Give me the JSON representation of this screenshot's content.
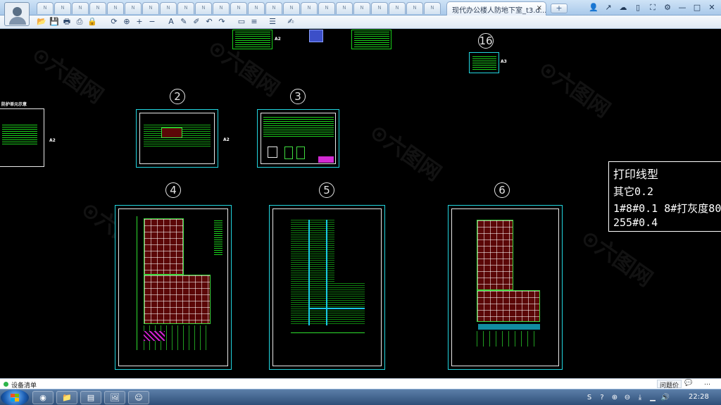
{
  "app": {
    "document_tab_title": "现代办公楼人防地下室_t3.d...",
    "tab_close_glyph": "×",
    "new_tab_glyph": "+",
    "mini_tabs": [
      "N",
      "N",
      "N",
      "N",
      "N",
      "N",
      "N",
      "N",
      "N",
      "N",
      "N",
      "N",
      "N",
      "N",
      "N",
      "N",
      "N",
      "N",
      "N",
      "N",
      "N",
      "N",
      "N"
    ],
    "window_controls": [
      "—",
      "□",
      "✕"
    ],
    "user_icons": [
      "👤",
      "↗",
      "☁",
      "▯",
      "⛶",
      "⚙"
    ]
  },
  "toolbar": {
    "icons": [
      "open-icon",
      "save-icon",
      "print-icon",
      "print-preview-icon",
      "lock-icon",
      "rotate-icon",
      "zoom-window-icon",
      "zoom-in-icon",
      "zoom-out-icon",
      "text-icon",
      "pen-icon",
      "highlight-icon",
      "undo-icon",
      "redo-icon",
      "layer-icon",
      "linetype-icon",
      "layers-stack-icon",
      "properties-icon"
    ],
    "glyphs": [
      "📂",
      "💾",
      "🖶",
      "⎙",
      "🔒",
      "⟳",
      "⊕",
      "+",
      "−",
      "A",
      "✎",
      "✐",
      "↶",
      "↷",
      "▭",
      "≡",
      "☰",
      "✍"
    ]
  },
  "drawing": {
    "sheet_numbers": [
      "2",
      "3",
      "4",
      "5",
      "6",
      "16"
    ],
    "sheet_size_marks": [
      "A2",
      "A3",
      "A2",
      "A2"
    ],
    "left_sheet_caption": "防护单元示意",
    "note": {
      "title": "打印线型",
      "line1": "其它0.2",
      "line2": "1#8#0.1   8#打灰度80",
      "line3": "255#0.4"
    }
  },
  "statusbar": {
    "label": "设备清单",
    "right_button": "问题价",
    "message_icon": "💬",
    "more": "…"
  },
  "taskbar": {
    "apps": [
      "◉",
      "📁",
      "▤",
      "🖼",
      "☺"
    ],
    "tray_icons": [
      "S",
      "?",
      "⊕",
      "⊖",
      "⤓",
      "▁",
      "🔊"
    ],
    "clock": "22:28"
  },
  "colors": {
    "canvas": "#000000",
    "sheet_border": "#22d6e0",
    "plan_fill": "#5b0707",
    "plan_outline": "#3fdc3f"
  }
}
